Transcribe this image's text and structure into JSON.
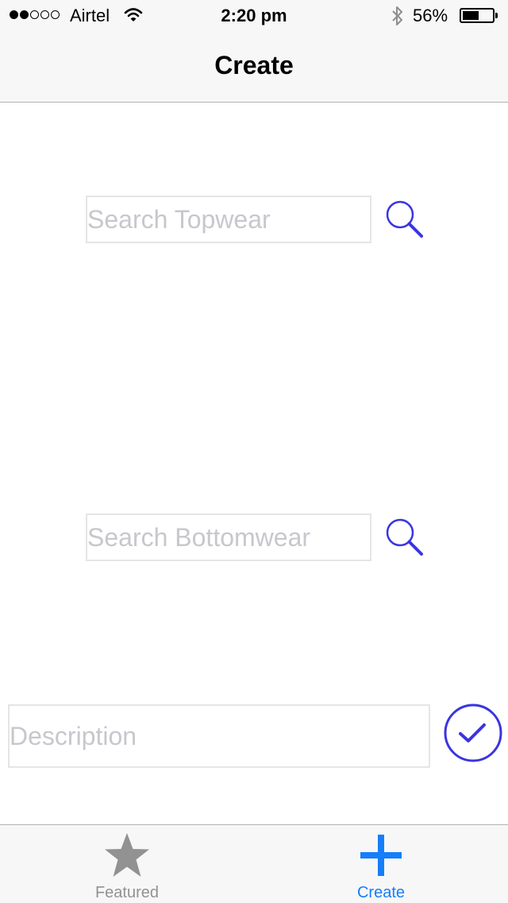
{
  "status_bar": {
    "signal_bars": 2,
    "signal_total": 5,
    "carrier": "Airtel",
    "time": "2:20 pm",
    "battery_percent": "56%",
    "battery_level": 0.56,
    "wifi_icon": "wifi-icon",
    "bluetooth_icon": "bluetooth-icon"
  },
  "nav": {
    "title": "Create"
  },
  "form": {
    "topwear_placeholder": "Search Topwear",
    "topwear_value": "",
    "bottomwear_placeholder": "Search Bottomwear",
    "bottomwear_value": "",
    "description_placeholder": "Description",
    "description_value": "",
    "search_icon": "search-icon",
    "submit_icon": "checkmark-circle-icon"
  },
  "tab_bar": {
    "tabs": [
      {
        "label": "Featured",
        "icon": "star-icon",
        "selected": false
      },
      {
        "label": "Create",
        "icon": "plus-icon",
        "selected": true
      }
    ]
  },
  "colors": {
    "accent": "#3a35e0",
    "tab_selected": "#147efb",
    "tab_unselected": "#929292",
    "placeholder": "#c7c7cd",
    "bar_background": "#f7f7f7"
  }
}
